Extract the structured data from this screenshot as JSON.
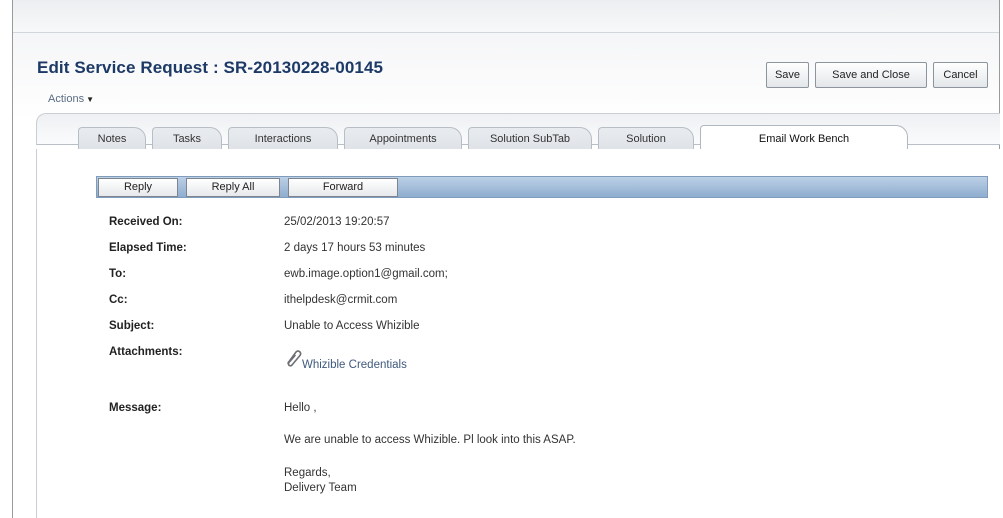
{
  "header": {
    "title": "Edit Service Request : SR-20130228-00145",
    "actions_label": "Actions",
    "buttons": {
      "save": "Save",
      "save_close": "Save and Close",
      "cancel": "Cancel"
    }
  },
  "tabs": [
    {
      "label": "Notes"
    },
    {
      "label": "Tasks"
    },
    {
      "label": "Interactions"
    },
    {
      "label": "Appointments"
    },
    {
      "label": "Solution SubTab"
    },
    {
      "label": "Solution"
    },
    {
      "label": "Email Work Bench",
      "active": true
    }
  ],
  "toolbar": {
    "reply": "Reply",
    "reply_all": "Reply All",
    "forward": "Forward"
  },
  "email": {
    "received_on": {
      "label": "Received On:",
      "value": "25/02/2013 19:20:57"
    },
    "elapsed_time": {
      "label": "Elapsed Time:",
      "value": "2 days 17 hours 53 minutes"
    },
    "to": {
      "label": "To:",
      "value": "ewb.image.option1@gmail.com;"
    },
    "cc": {
      "label": "Cc:",
      "value": "ithelpdesk@crmit.com"
    },
    "subject": {
      "label": "Subject:",
      "value": "Unable to Access Whizible"
    },
    "attachments": {
      "label": "Attachments:",
      "value": "Whizible Credentials",
      "icon": "paperclip-icon"
    },
    "message": {
      "label": "Message:",
      "greeting": "Hello ,",
      "body": "We are unable to access Whizible. Pl look into this ASAP.",
      "closing": "Regards,",
      "signature": "Delivery Team"
    }
  }
}
